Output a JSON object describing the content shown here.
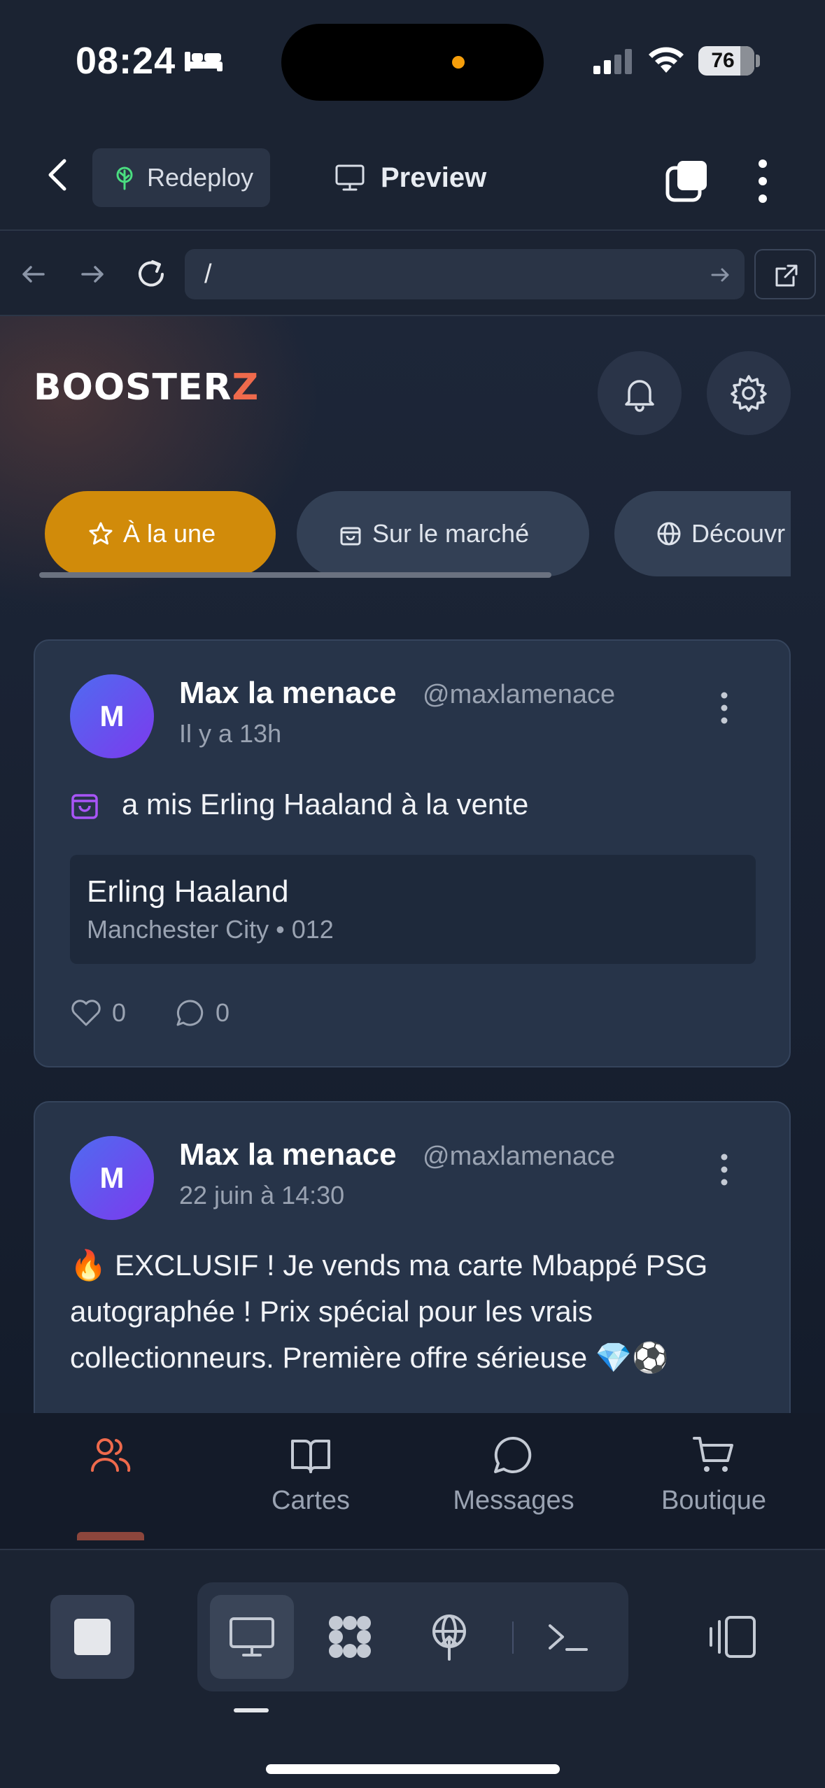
{
  "status_bar": {
    "time": "08:24",
    "battery": "76"
  },
  "app_header": {
    "redeploy_label": "Redeploy",
    "preview_label": "Preview"
  },
  "url_bar": {
    "url": "/"
  },
  "site": {
    "logo_main": "BOOSTER",
    "logo_accent": "Z",
    "accent_color": "#ef6a4c",
    "chips": [
      {
        "label": "À la une",
        "icon": "star-icon",
        "active": true,
        "color": "#d18b0a"
      },
      {
        "label": "Sur le marché",
        "icon": "shopping-bag-icon"
      },
      {
        "label": "Découvr",
        "icon": "globe-icon"
      }
    ]
  },
  "posts": [
    {
      "avatar_letter": "M",
      "name": "Max la menace",
      "handle": "@maxlamenace",
      "time": "Il y a 13h",
      "action_text": "a mis Erling Haaland à la vente",
      "item": {
        "name": "Erling Haaland",
        "detail": "Manchester City • 012"
      },
      "likes": "0",
      "comments": "0"
    },
    {
      "avatar_letter": "M",
      "name": "Max la menace",
      "handle": "@maxlamenace",
      "time": "22 juin à 14:30",
      "text": "🔥 EXCLUSIF ! Je vends ma carte Mbappé PSG autographée ! Prix spécial pour les vrais collectionneurs. Première offre sérieuse 💎⚽"
    }
  ],
  "bottom_nav": {
    "items": [
      {
        "label": "",
        "icon": "users-icon",
        "active": true
      },
      {
        "label": "Cartes",
        "icon": "book-icon"
      },
      {
        "label": "Messages",
        "icon": "chat-icon"
      },
      {
        "label": "Boutique",
        "icon": "cart-icon"
      }
    ]
  }
}
